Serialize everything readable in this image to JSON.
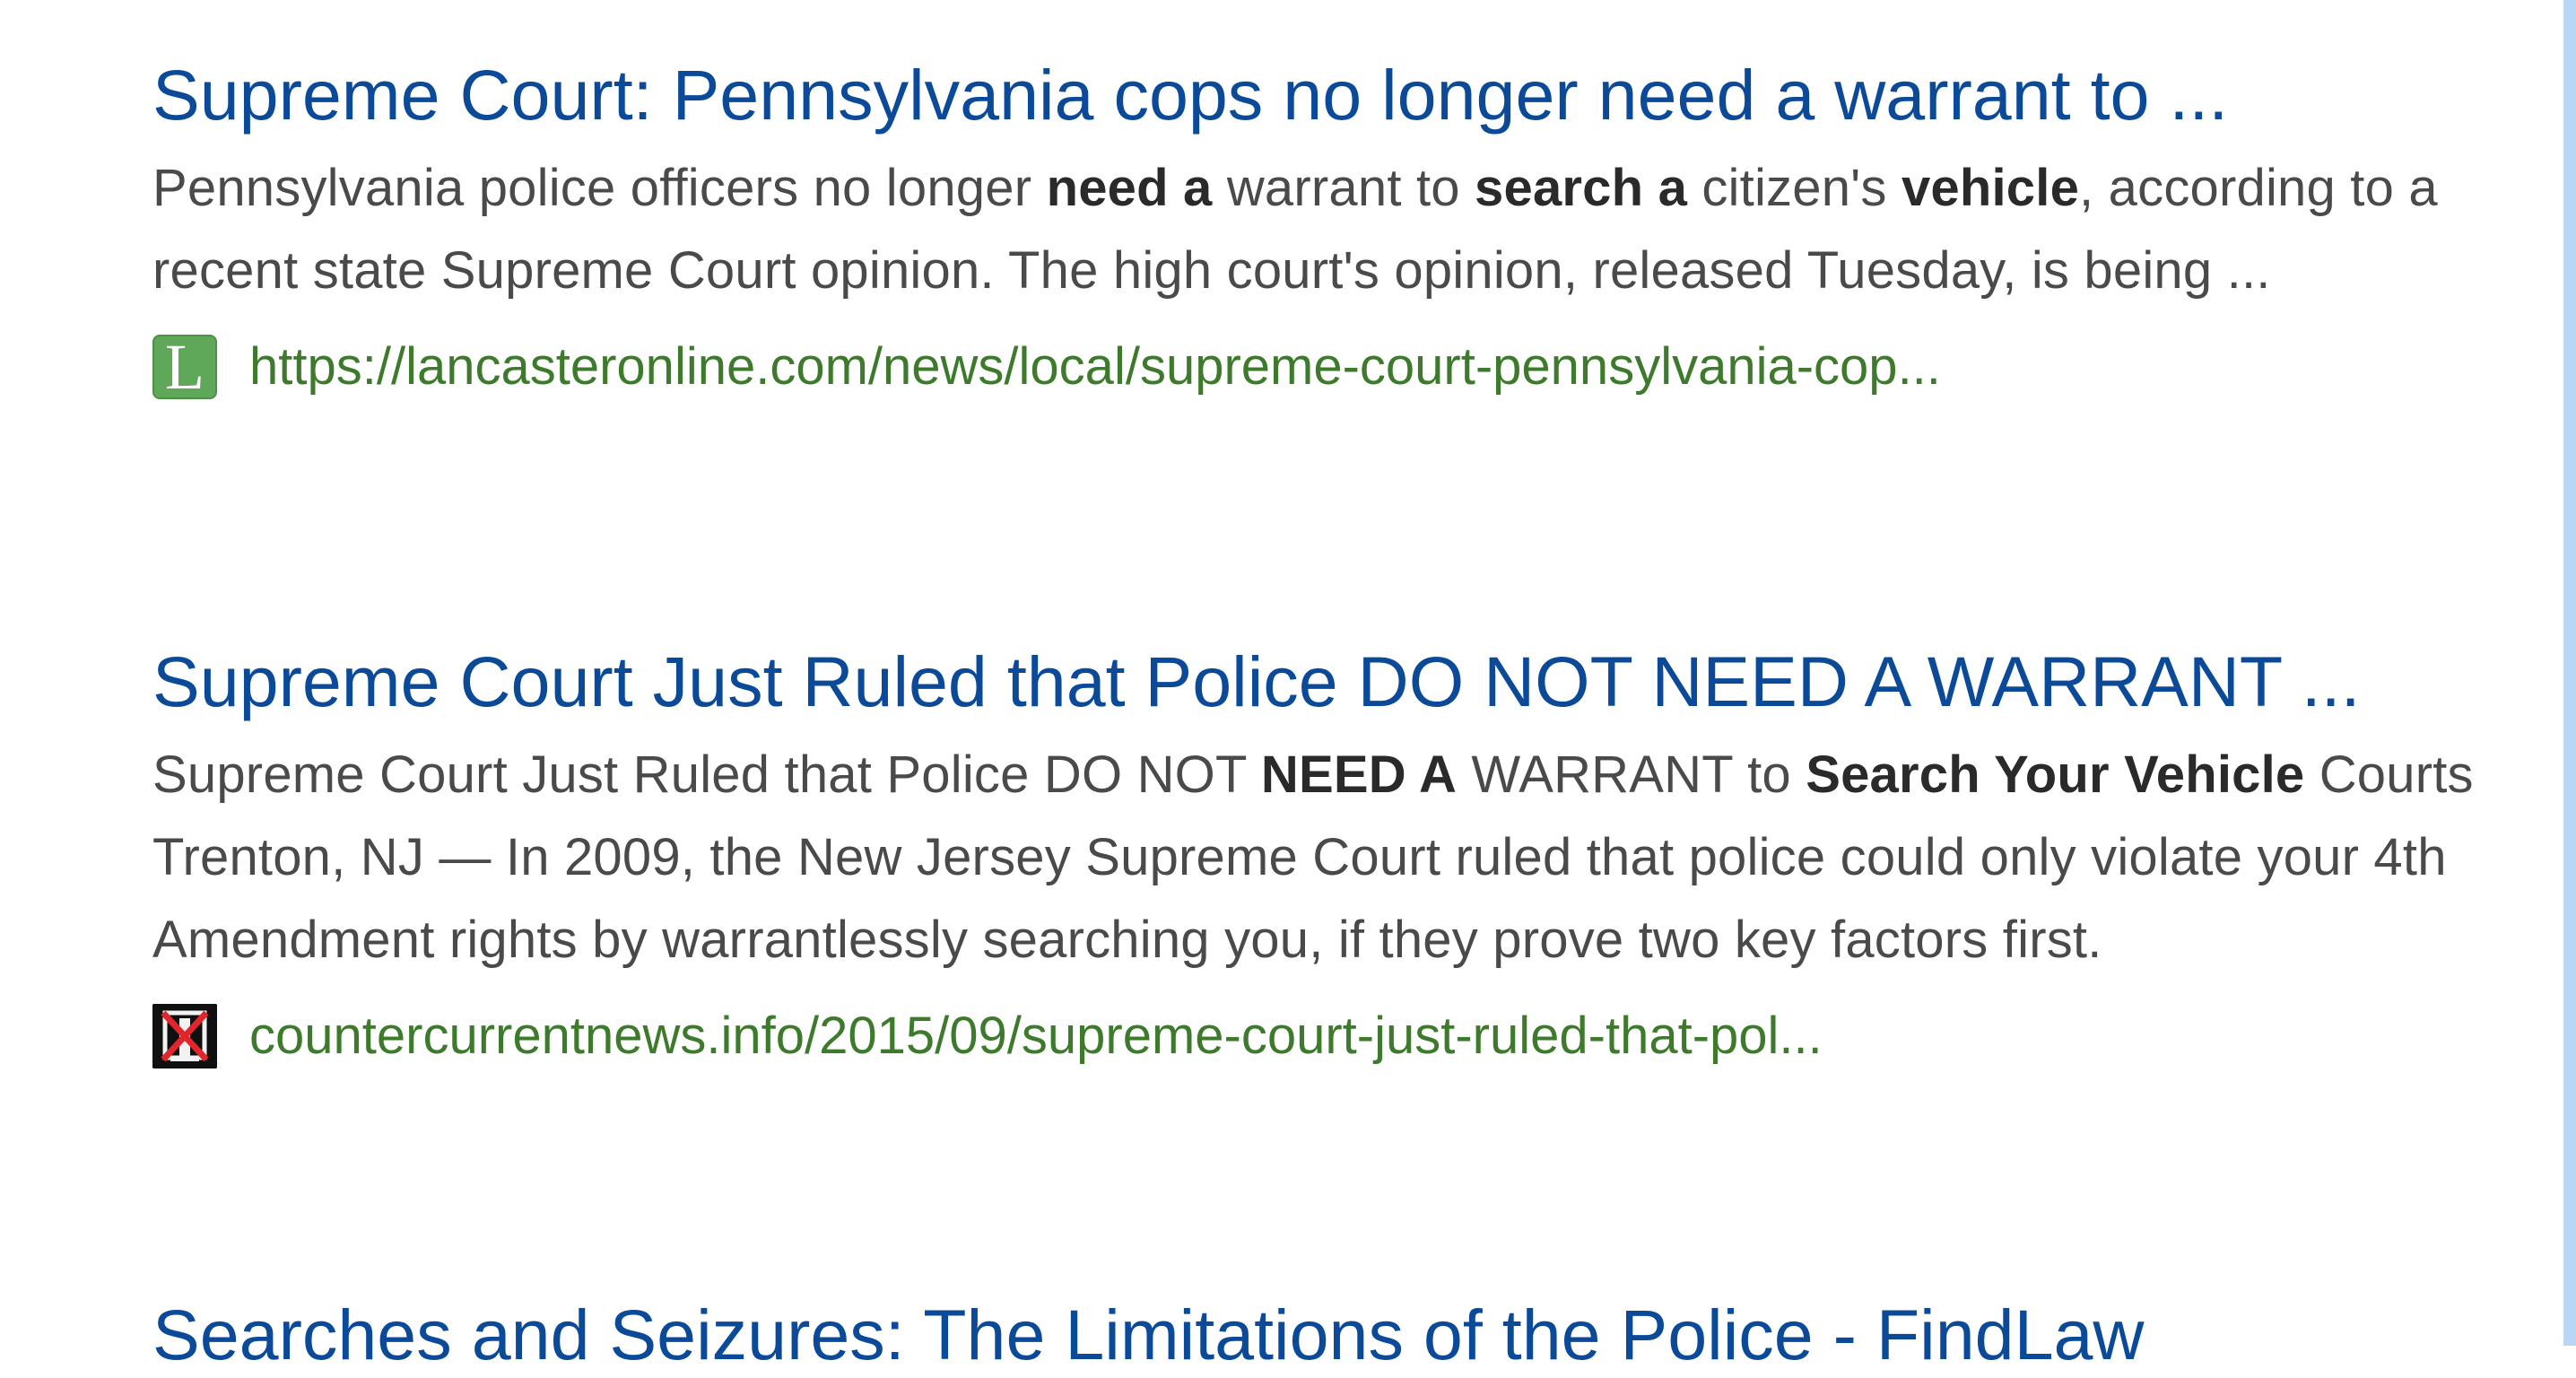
{
  "results": [
    {
      "title": "Supreme Court: Pennsylvania cops no longer need a warrant to ...",
      "snippet": [
        {
          "text": "Pennsylvania police officers no longer ",
          "bold": false
        },
        {
          "text": "need a",
          "bold": true
        },
        {
          "text": " warrant to ",
          "bold": false
        },
        {
          "text": "search a",
          "bold": true
        },
        {
          "text": " citizen's ",
          "bold": false
        },
        {
          "text": "vehicle",
          "bold": true
        },
        {
          "text": ", according to a recent state Supreme Court opinion. The high court's opinion, released Tuesday, is being ...",
          "bold": false
        }
      ],
      "favicon": {
        "icon": "lancasteronline-favicon-icon",
        "letter": "L",
        "color": "#5fa85a"
      },
      "url": "https://lancasteronline.com/news/local/supreme-court-pennsylvania-cop..."
    },
    {
      "title": "Supreme Court Just Ruled that Police DO NOT NEED A WARRANT ...",
      "snippet": [
        {
          "text": "Supreme Court Just Ruled that Police DO NOT ",
          "bold": false
        },
        {
          "text": "NEED A",
          "bold": true
        },
        {
          "text": " WARRANT to ",
          "bold": false
        },
        {
          "text": "Search Your Vehicle",
          "bold": true
        },
        {
          "text": " Courts Trenton, NJ — In 2009, the New Jersey Supreme Court ruled that police could only violate your 4th Amendment rights by warrantlessly searching you, if they prove two key factors first.",
          "bold": false
        }
      ],
      "favicon": {
        "icon": "countercurrentnews-favicon-icon",
        "color": "#101010"
      },
      "url": "countercurrentnews.info/2015/09/supreme-court-just-ruled-that-pol..."
    },
    {
      "title": "Searches and Seizures: The Limitations of the Police - FindLaw"
    }
  ],
  "colors": {
    "title": "#0b4a99",
    "snippet": "#4a4a4a",
    "url": "#3d7a2c",
    "scroll_edge": "#cfe2f7"
  }
}
